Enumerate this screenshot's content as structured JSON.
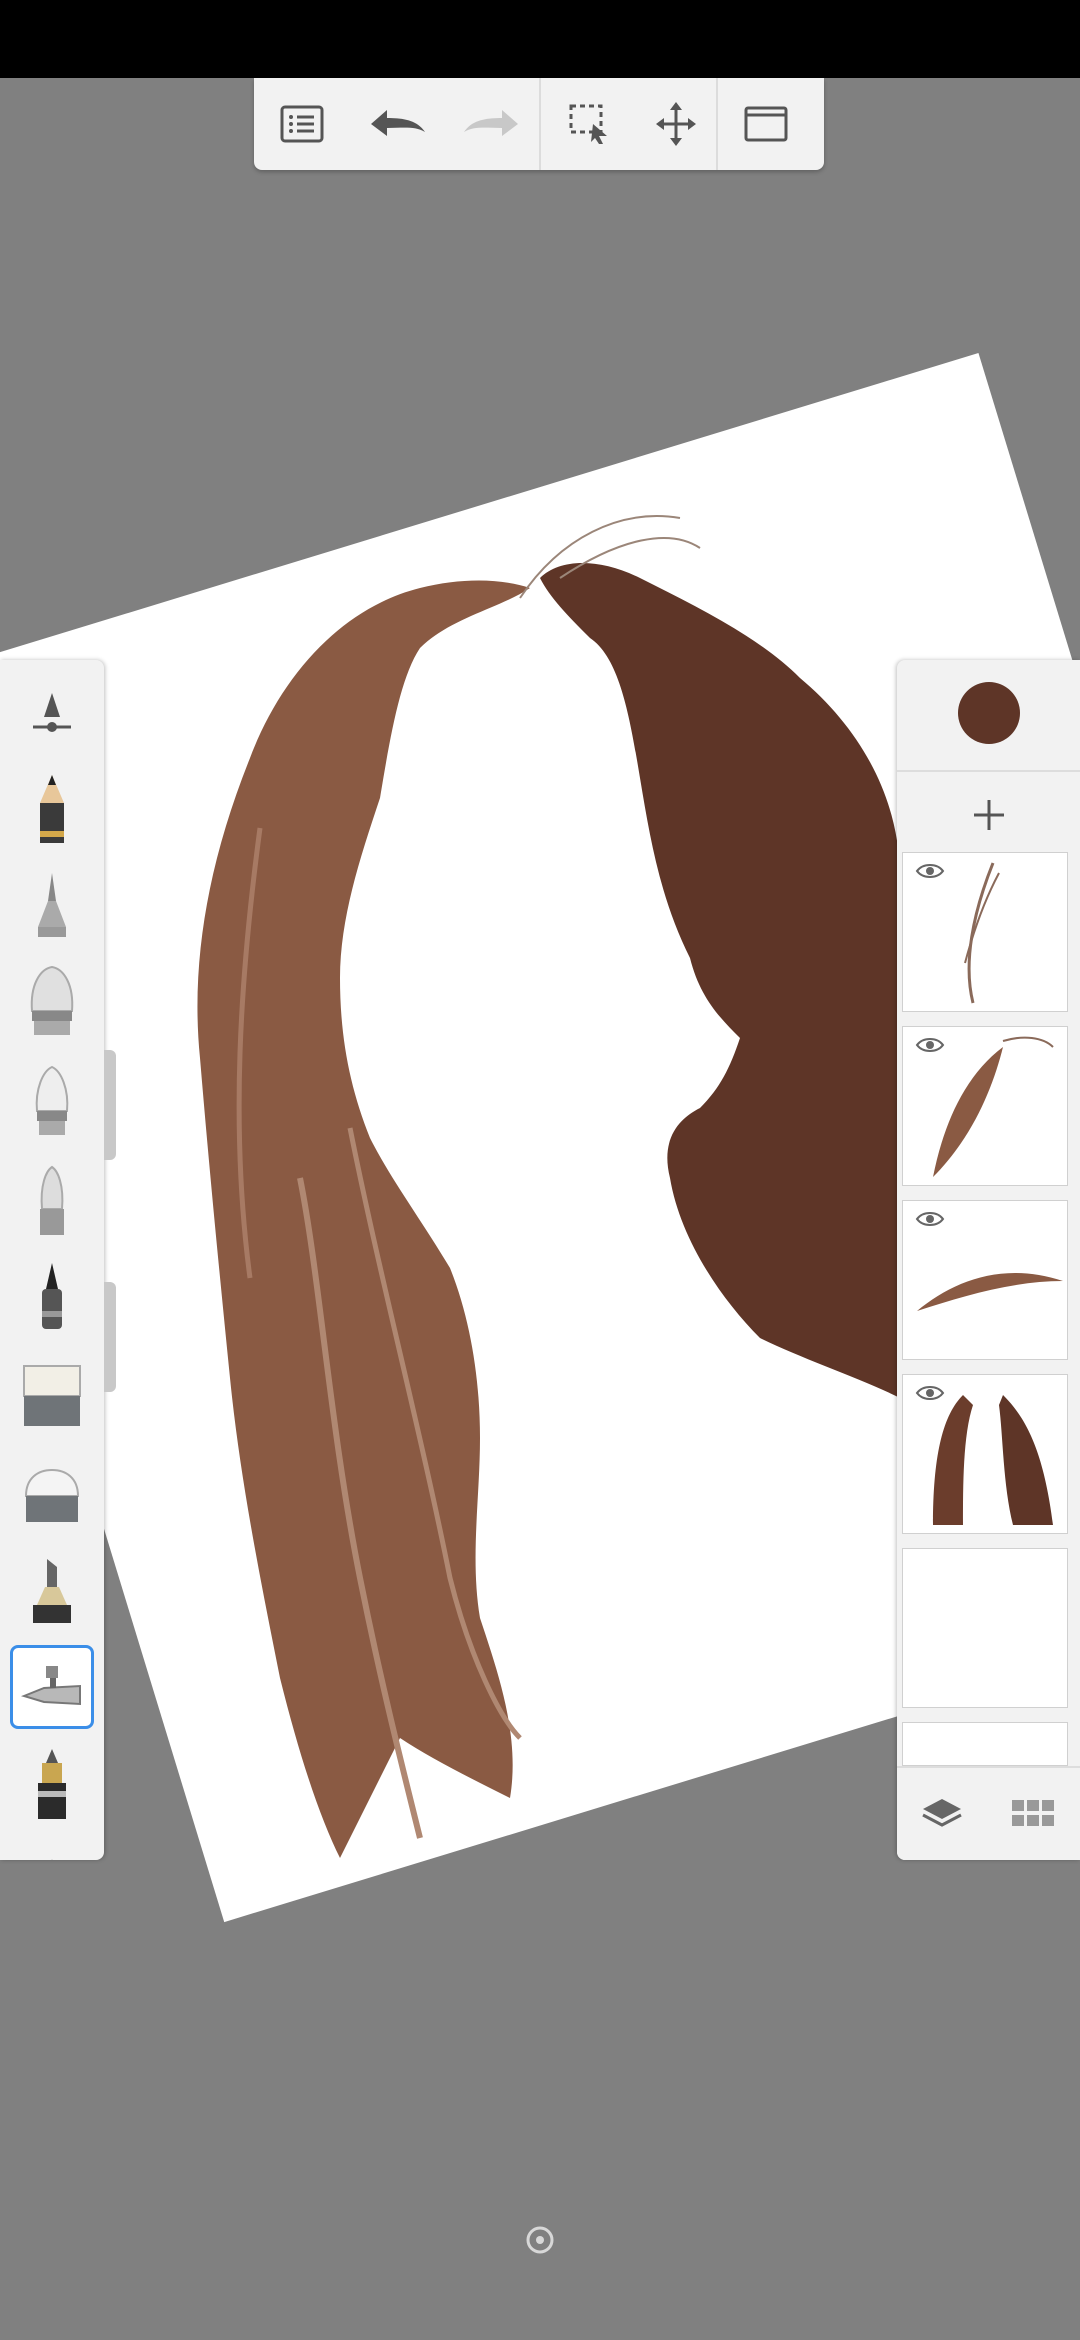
{
  "app": {
    "accent_color": "#3b8ee8",
    "current_color": "#5e3527"
  },
  "top_toolbar": {
    "items": [
      {
        "name": "list-menu-icon"
      },
      {
        "name": "undo-icon"
      },
      {
        "name": "redo-icon"
      },
      {
        "name": "selection-icon"
      },
      {
        "name": "transform-icon"
      },
      {
        "name": "fullscreen-icon"
      }
    ]
  },
  "brush_palette": {
    "brushes": [
      {
        "name": "brush-properties-icon"
      },
      {
        "name": "pencil-icon"
      },
      {
        "name": "ballpoint-pen-icon"
      },
      {
        "name": "paint-brush-icon"
      },
      {
        "name": "airbrush-icon"
      },
      {
        "name": "soft-brush-icon"
      },
      {
        "name": "fine-tip-pen-icon"
      },
      {
        "name": "hard-eraser-icon"
      },
      {
        "name": "soft-eraser-icon"
      },
      {
        "name": "marker-icon"
      },
      {
        "name": "airbrush-nozzle-icon",
        "selected": true
      },
      {
        "name": "ink-pen-icon"
      }
    ]
  },
  "layer_panel": {
    "layers": [
      {
        "name": "layer-strands",
        "visible": true
      },
      {
        "name": "layer-lock-left",
        "visible": true
      },
      {
        "name": "layer-eyebrow",
        "visible": true
      },
      {
        "name": "layer-hair-base",
        "visible": true
      },
      {
        "name": "layer-reference-photo",
        "visible": false
      },
      {
        "name": "layer-reference-photo-2",
        "visible": false
      }
    ]
  }
}
